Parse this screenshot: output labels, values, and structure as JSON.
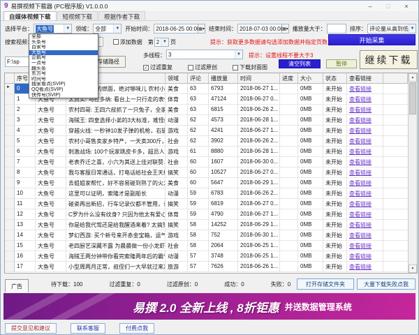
{
  "window": {
    "title": "易撰视频下载器 (PC程序版) V1.0.0.0",
    "icon": "9",
    "controls": {
      "minimize": "–",
      "maximize": "□",
      "close": "×"
    }
  },
  "tabs": [
    {
      "label": "自媒体视频下载"
    },
    {
      "label": "短视频下载"
    },
    {
      "label": "根据作者下载"
    }
  ],
  "filters": {
    "platform_label": "选择平台：",
    "platform_value": "大鱼号",
    "field_label": "领域：",
    "field_value": "全部",
    "start_label": "开始时间：",
    "start_value": "2018-06-25 00:00",
    "end_label": "结束时间：",
    "end_value": "2018-07-03 00:00",
    "plays_label": "播放量大于：",
    "plays_value": "",
    "sort_label": "排序：",
    "sort_value": "评论量从高到低"
  },
  "platform_dropdown": {
    "selected": "大鱼号",
    "items": [
      "全部",
      "头条号",
      "百家号",
      "大鱼号",
      "企鹅号",
      "一点号",
      "趣头条",
      "东方号",
      "时间号",
      "独家看点(SVIP)",
      "QQ看点(SVIP)",
      "快传号(SVIP)"
    ]
  },
  "search_row": {
    "search_label": "搜索视频：",
    "search_value": "",
    "add_data_label": "添加数据",
    "page_prefix": "第",
    "page_value": "2",
    "page_suffix": "页",
    "hint": "提示：获取更多数据请勾选添加数据并指定页数",
    "collect_button": "开始采集"
  },
  "path_row": {
    "path_value": "F:\\sp",
    "choose_path_button": "选择存储路径",
    "threads_label": "多线程：",
    "threads_value": "3",
    "threads_hint": "提示：设置线程不要大于3",
    "filter_dup_label": "过滤重复",
    "filter_orig_label": "过滤原创",
    "download_cover_label": "下载封面图",
    "clear_button": "清空列表",
    "pause_button": "暂停",
    "continue_button": "继续下载"
  },
  "table": {
    "columns": [
      "序号",
      "平台",
      "标题",
      "领域",
      "评论",
      "播放量",
      "时间",
      "进度",
      "大小",
      "状态",
      "查看链接"
    ],
    "link_text": "查看链接",
    "rows": [
      {
        "seq": "0",
        "platform": "大鱼号",
        "title": "宜宾最出名的燃面，绝对够味儿 农村小...",
        "field": "美食",
        "comments": "63",
        "plays": "6793",
        "time": "2018-06-27 1...",
        "progress": "",
        "size": "0MB",
        "status": "未开始"
      },
      {
        "seq": "1",
        "platform": "大鱼号",
        "title": "太真实! 马拉多纳: 看台上一只行走的表情包",
        "field": "体育",
        "comments": "63",
        "plays": "47124",
        "time": "2018-06-27 0...",
        "progress": "",
        "size": "0MB",
        "status": "未开始"
      },
      {
        "seq": "2",
        "platform": "大鱼号",
        "title": "农村四哥: 王四六叔抓了一只兔子，全家...",
        "field": "美食",
        "comments": "63",
        "plays": "6815",
        "time": "2018-06-26 2...",
        "progress": "",
        "size": "0MB",
        "status": "未开始"
      },
      {
        "seq": "3",
        "platform": "大鱼号",
        "title": "海贼王: 四皇选择小弟的3大标准，难怪红...",
        "field": "动漫",
        "comments": "62",
        "plays": "4573",
        "time": "2018-06-28 1...",
        "progress": "",
        "size": "0MB",
        "status": "未开始"
      },
      {
        "seq": "4",
        "platform": "大鱼号",
        "title": "穿越火线: 一秒钟10发子弹的机枪，右键...",
        "field": "游戏",
        "comments": "62",
        "plays": "4241",
        "time": "2018-06-27 1...",
        "progress": "",
        "size": "0MB",
        "status": "未开始"
      },
      {
        "seq": "5",
        "platform": "大鱼号",
        "title": "农村小哥售卖家乡特产，一天卖300斤，吃...",
        "field": "社会",
        "comments": "62",
        "plays": "3902",
        "time": "2018-06-26 2...",
        "progress": "",
        "size": "0MB",
        "status": "未开始"
      },
      {
        "seq": "6",
        "platform": "大鱼号",
        "title": "刺激战场: 100个玩家跳皮卡多，超员人去...",
        "field": "游戏",
        "comments": "61",
        "plays": "8880",
        "time": "2018-06-28 1...",
        "progress": "",
        "size": "0MB",
        "status": "未开始"
      },
      {
        "seq": "7",
        "platform": "大鱼号",
        "title": "老表乔迁之喜，小六为其送上佳对联赞...",
        "field": "社会",
        "comments": "60",
        "plays": "1607",
        "time": "2018-06-30 0...",
        "progress": "",
        "size": "0MB",
        "status": "未开始"
      },
      {
        "seq": "8",
        "platform": "大鱼号",
        "title": "我与客服日常通话，打电话给社会王天枢...",
        "field": "搞笑",
        "comments": "60",
        "plays": "10527",
        "time": "2018-06-27 0...",
        "progress": "",
        "size": "0MB",
        "status": "未开始"
      },
      {
        "seq": "9",
        "platform": "大鱼号",
        "title": "去姐姐家帮忙，好不容易碰到熟了的火龙...",
        "field": "美食",
        "comments": "60",
        "plays": "5647",
        "time": "2018-06-29 1...",
        "progress": "",
        "size": "0MB",
        "status": "未开始"
      },
      {
        "seq": "10",
        "platform": "大鱼号",
        "title": "这里可以证明，索隆才是副船长",
        "field": "动漫",
        "comments": "59",
        "plays": "6783",
        "time": "2018-06-26 2...",
        "progress": "",
        "size": "0MB",
        "status": "未开始"
      },
      {
        "seq": "11",
        "platform": "大鱼号",
        "title": "碰瓷再出新招，行车记录仪都不管用，让...",
        "field": "搞笑",
        "comments": "59",
        "plays": "6819",
        "time": "2018-06-27 0...",
        "progress": "",
        "size": "0MB",
        "status": "未开始"
      },
      {
        "seq": "12",
        "platform": "大鱼号",
        "title": "C罗为什么没有纹身? 只因为他太有爱心...",
        "field": "体育",
        "comments": "59",
        "plays": "4790",
        "time": "2018-06-27 1...",
        "progress": "",
        "size": "0MB",
        "status": "未开始"
      },
      {
        "seq": "13",
        "platform": "大鱼号",
        "title": "你是给我代驾还是给我醒酒来着? 太搞笑了",
        "field": "搞笑",
        "comments": "58",
        "plays": "14252",
        "time": "2018-06-29 1...",
        "progress": "",
        "size": "0MB",
        "status": "未开始"
      },
      {
        "seq": "14",
        "platform": "大鱼号",
        "title": "梦幻西游: 买个新号来开赤金宝箱，运气...",
        "field": "游戏",
        "comments": "58",
        "plays": "752",
        "time": "2018-06-30 1...",
        "progress": "",
        "size": "0MB",
        "status": "未开始"
      },
      {
        "seq": "15",
        "platform": "大鱼号",
        "title": "老四厨艺深藏不露 为晨晨做一份小龙虾晨...",
        "field": "社会",
        "comments": "58",
        "plays": "2064",
        "time": "2018-06-25 1...",
        "progress": "",
        "size": "0MB",
        "status": "未开始"
      },
      {
        "seq": "16",
        "platform": "大鱼号",
        "title": "海贼王两分钟带你看完索隆两年后的霸气瞬间",
        "field": "动漫",
        "comments": "57",
        "plays": "3748",
        "time": "2018-06-25 1...",
        "progress": "",
        "size": "0MB",
        "status": "未开始"
      },
      {
        "seq": "17",
        "platform": "大鱼号",
        "title": "小型周两月正常，叔侄们一大早就过来准...",
        "field": "旅游",
        "comments": "57",
        "plays": "7626",
        "time": "2018-06-26 1...",
        "progress": "",
        "size": "0MB",
        "status": "未开始"
      }
    ]
  },
  "statusbar": {
    "ad_tab": "广告",
    "items": [
      {
        "label": "待下载：",
        "value": "100"
      },
      {
        "label": "过滤重复：",
        "value": "0"
      },
      {
        "label": "过滤原创：",
        "value": "0"
      },
      {
        "label": "成功：",
        "value": "0"
      },
      {
        "label": "失败：",
        "value": "0"
      }
    ],
    "open_folder_button": "打开存储文件夹",
    "fail_help_button": "大量下载失败点我"
  },
  "banner": {
    "main": "易撰 2.0 全新上线 , 8折钜惠",
    "sub": "并送数据管理系统"
  },
  "footer": {
    "buttons": [
      "提交意见和建议",
      "联系客服",
      "付费点我"
    ]
  },
  "colors": {
    "accent_blue": "#2a1fd0",
    "hint_red": "#e01212",
    "link_purple": "#6a35c8",
    "selection_blue": "#316ac5",
    "banner_magenta": "#c5269b"
  }
}
